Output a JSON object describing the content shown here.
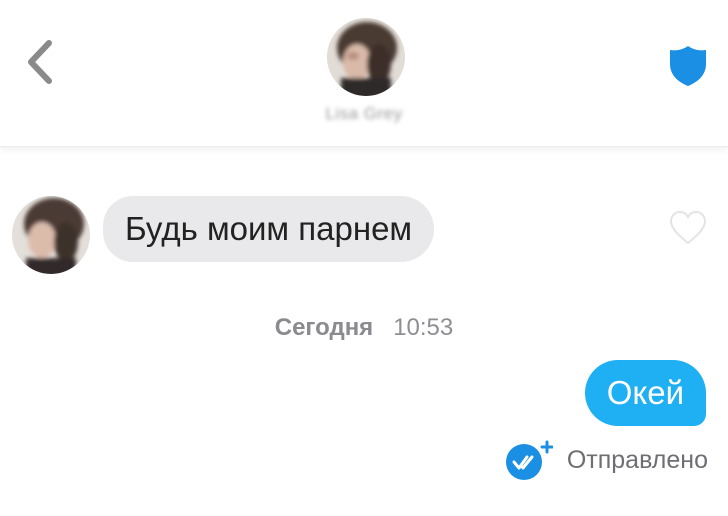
{
  "header": {
    "contact_name": "Lisa Grey",
    "back_icon": "chevron-left-icon",
    "shield_icon": "shield-icon"
  },
  "messages": {
    "incoming": {
      "text": "Будь моим парнем",
      "like_icon": "heart-outline-icon"
    },
    "timestamp": {
      "day": "Сегодня",
      "time": "10:53"
    },
    "outgoing": {
      "text": "Окей",
      "status": "Отправлено",
      "status_icon": "double-check-icon"
    }
  },
  "colors": {
    "accent": "#1fb0f3",
    "shield": "#1a8fe3",
    "incoming_bubble": "#e9e9eb"
  }
}
